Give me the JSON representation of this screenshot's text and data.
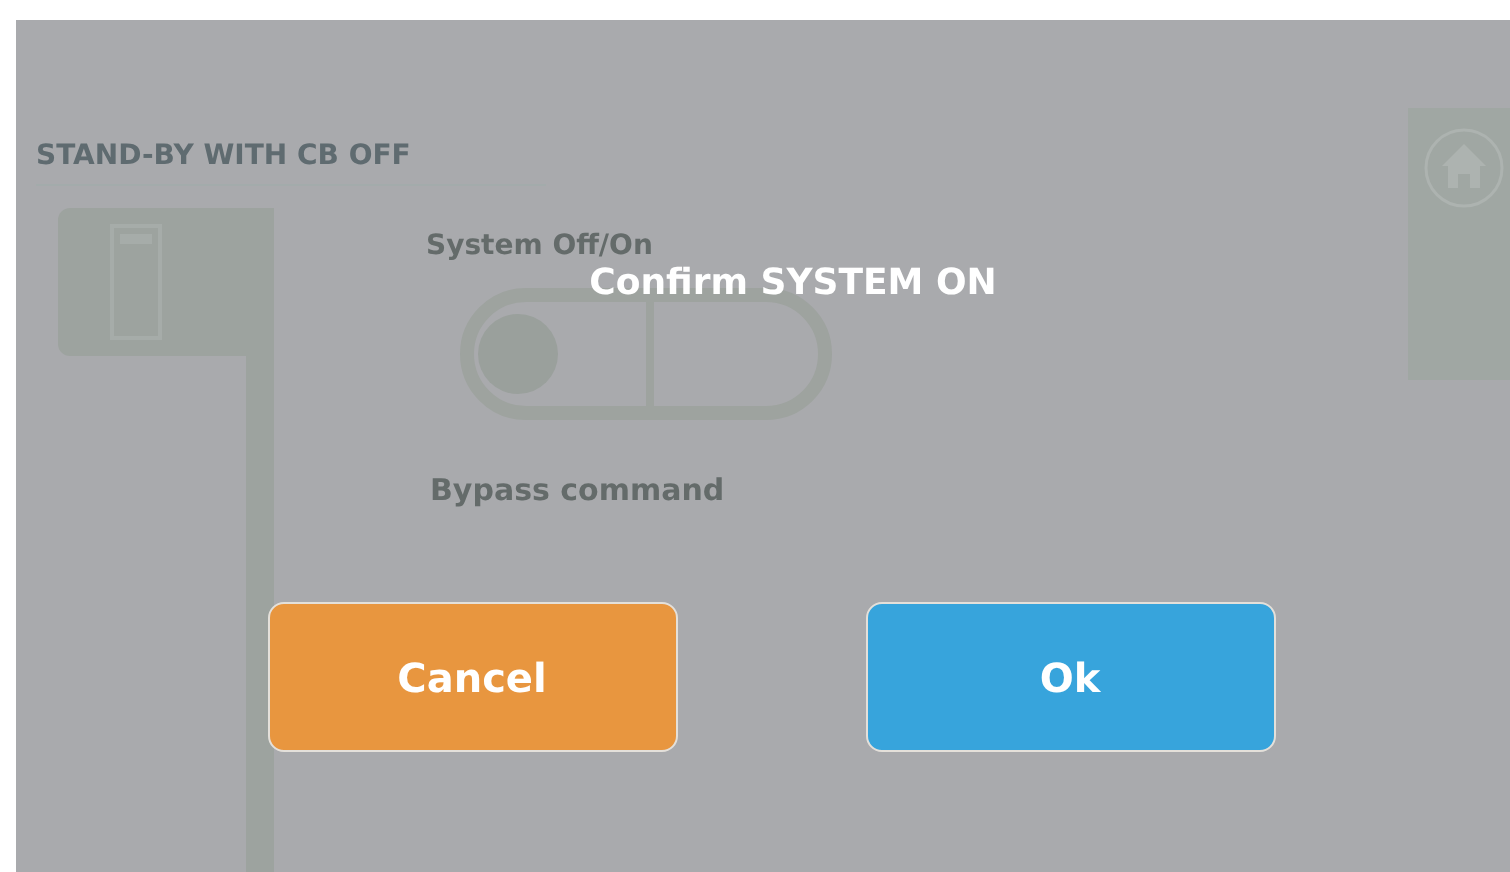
{
  "screen": {
    "status": "STAND-BY WITH CB OFF",
    "system_label": "System Off/On",
    "system_switch": {
      "on": false
    },
    "bypass_label": "Bypass command"
  },
  "dialog": {
    "title": "Confirm SYSTEM ON",
    "buttons": [
      {
        "label": "Cancel",
        "kind": "cancel"
      },
      {
        "label": "Ok",
        "kind": "confirm"
      }
    ]
  }
}
